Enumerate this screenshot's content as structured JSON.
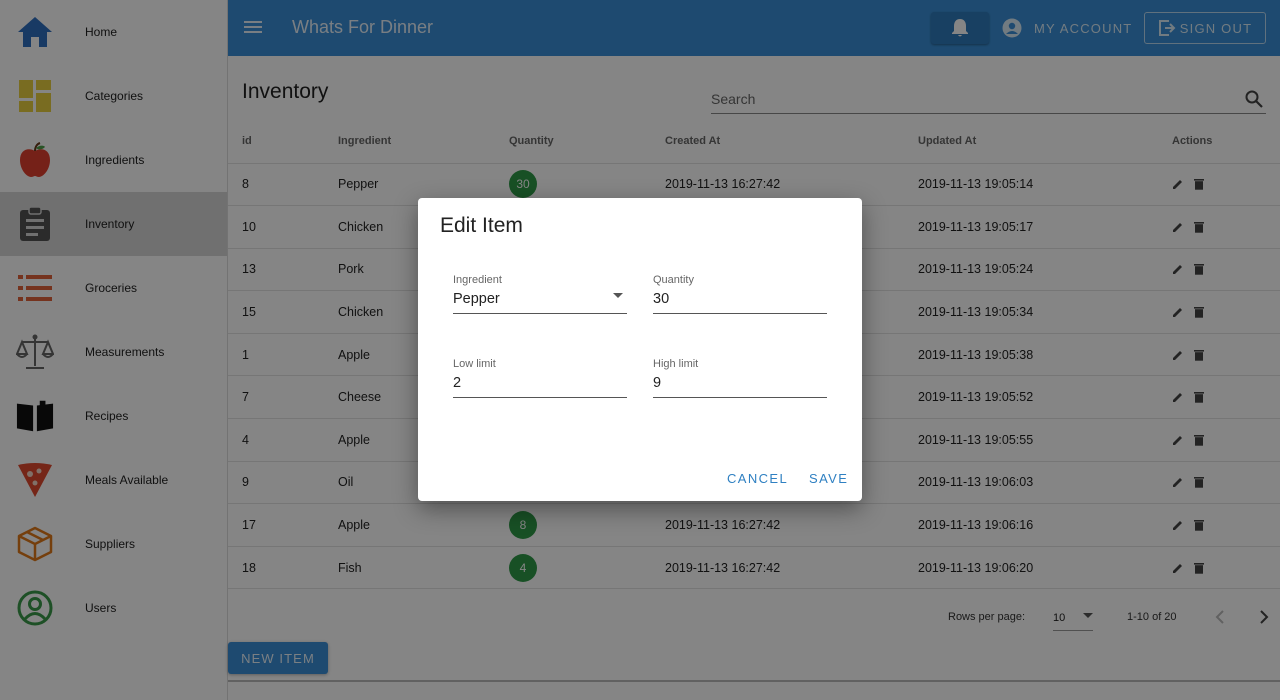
{
  "app": {
    "title": "Whats For Dinner"
  },
  "colors": {
    "primary": "#3a8fd6",
    "badge": "#2e9a48",
    "active_nav": "#d6d6d6"
  },
  "sidebar": {
    "items": [
      {
        "label": "Home",
        "icon": "home-icon"
      },
      {
        "label": "Categories",
        "icon": "categories-icon"
      },
      {
        "label": "Ingredients",
        "icon": "apple-icon"
      },
      {
        "label": "Inventory",
        "icon": "clipboard-icon",
        "active": true
      },
      {
        "label": "Groceries",
        "icon": "list-icon"
      },
      {
        "label": "Measurements",
        "icon": "scale-icon"
      },
      {
        "label": "Recipes",
        "icon": "book-icon"
      },
      {
        "label": "Meals Available",
        "icon": "pizza-icon"
      },
      {
        "label": "Suppliers",
        "icon": "box-icon"
      },
      {
        "label": "Users",
        "icon": "user-icon"
      }
    ]
  },
  "header": {
    "account_label": "MY ACCOUNT",
    "signout_label": "SIGN OUT"
  },
  "main": {
    "title": "Inventory",
    "search_placeholder": "Search",
    "columns": [
      "id",
      "Ingredient",
      "Quantity",
      "Created At",
      "Updated At",
      "Actions"
    ],
    "rows": [
      {
        "id": "8",
        "ingredient": "Pepper",
        "quantity": "30",
        "created": "2019-11-13 16:27:42",
        "updated": "2019-11-13 19:05:14"
      },
      {
        "id": "10",
        "ingredient": "Chicken",
        "quantity": "",
        "created": "",
        "updated": "2019-11-13 19:05:17"
      },
      {
        "id": "13",
        "ingredient": "Pork",
        "quantity": "",
        "created": "",
        "updated": "2019-11-13 19:05:24"
      },
      {
        "id": "15",
        "ingredient": "Chicken",
        "quantity": "",
        "created": "",
        "updated": "2019-11-13 19:05:34"
      },
      {
        "id": "1",
        "ingredient": "Apple",
        "quantity": "",
        "created": "",
        "updated": "2019-11-13 19:05:38"
      },
      {
        "id": "7",
        "ingredient": "Cheese",
        "quantity": "",
        "created": "",
        "updated": "2019-11-13 19:05:52"
      },
      {
        "id": "4",
        "ingredient": "Apple",
        "quantity": "",
        "created": "",
        "updated": "2019-11-13 19:05:55"
      },
      {
        "id": "9",
        "ingredient": "Oil",
        "quantity": "",
        "created": "",
        "updated": "2019-11-13 19:06:03"
      },
      {
        "id": "17",
        "ingredient": "Apple",
        "quantity": "8",
        "created": "2019-11-13 16:27:42",
        "updated": "2019-11-13 19:06:16"
      },
      {
        "id": "18",
        "ingredient": "Fish",
        "quantity": "4",
        "created": "2019-11-13 16:27:42",
        "updated": "2019-11-13 19:06:20"
      }
    ],
    "pagination": {
      "rows_label": "Rows per page:",
      "rows_value": "10",
      "range": "1-10 of 20"
    },
    "new_item_label": "NEW ITEM"
  },
  "dialog": {
    "title": "Edit Item",
    "ingredient_label": "Ingredient",
    "ingredient_value": "Pepper",
    "quantity_label": "Quantity",
    "quantity_value": "30",
    "low_label": "Low limit",
    "low_value": "2",
    "high_label": "High limit",
    "high_value": "9",
    "cancel_label": "CANCEL",
    "save_label": "SAVE"
  }
}
